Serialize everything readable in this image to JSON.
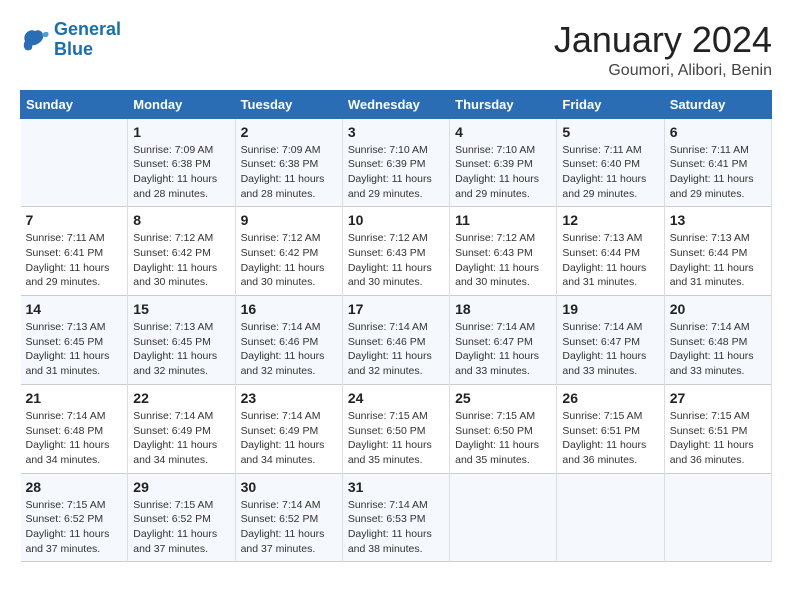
{
  "logo": {
    "line1": "General",
    "line2": "Blue"
  },
  "title": "January 2024",
  "location": "Goumori, Alibori, Benin",
  "headers": [
    "Sunday",
    "Monday",
    "Tuesday",
    "Wednesday",
    "Thursday",
    "Friday",
    "Saturday"
  ],
  "weeks": [
    [
      {
        "day": "",
        "info": ""
      },
      {
        "day": "1",
        "info": "Sunrise: 7:09 AM\nSunset: 6:38 PM\nDaylight: 11 hours\nand 28 minutes."
      },
      {
        "day": "2",
        "info": "Sunrise: 7:09 AM\nSunset: 6:38 PM\nDaylight: 11 hours\nand 28 minutes."
      },
      {
        "day": "3",
        "info": "Sunrise: 7:10 AM\nSunset: 6:39 PM\nDaylight: 11 hours\nand 29 minutes."
      },
      {
        "day": "4",
        "info": "Sunrise: 7:10 AM\nSunset: 6:39 PM\nDaylight: 11 hours\nand 29 minutes."
      },
      {
        "day": "5",
        "info": "Sunrise: 7:11 AM\nSunset: 6:40 PM\nDaylight: 11 hours\nand 29 minutes."
      },
      {
        "day": "6",
        "info": "Sunrise: 7:11 AM\nSunset: 6:41 PM\nDaylight: 11 hours\nand 29 minutes."
      }
    ],
    [
      {
        "day": "7",
        "info": "Sunrise: 7:11 AM\nSunset: 6:41 PM\nDaylight: 11 hours\nand 29 minutes."
      },
      {
        "day": "8",
        "info": "Sunrise: 7:12 AM\nSunset: 6:42 PM\nDaylight: 11 hours\nand 30 minutes."
      },
      {
        "day": "9",
        "info": "Sunrise: 7:12 AM\nSunset: 6:42 PM\nDaylight: 11 hours\nand 30 minutes."
      },
      {
        "day": "10",
        "info": "Sunrise: 7:12 AM\nSunset: 6:43 PM\nDaylight: 11 hours\nand 30 minutes."
      },
      {
        "day": "11",
        "info": "Sunrise: 7:12 AM\nSunset: 6:43 PM\nDaylight: 11 hours\nand 30 minutes."
      },
      {
        "day": "12",
        "info": "Sunrise: 7:13 AM\nSunset: 6:44 PM\nDaylight: 11 hours\nand 31 minutes."
      },
      {
        "day": "13",
        "info": "Sunrise: 7:13 AM\nSunset: 6:44 PM\nDaylight: 11 hours\nand 31 minutes."
      }
    ],
    [
      {
        "day": "14",
        "info": "Sunrise: 7:13 AM\nSunset: 6:45 PM\nDaylight: 11 hours\nand 31 minutes."
      },
      {
        "day": "15",
        "info": "Sunrise: 7:13 AM\nSunset: 6:45 PM\nDaylight: 11 hours\nand 32 minutes."
      },
      {
        "day": "16",
        "info": "Sunrise: 7:14 AM\nSunset: 6:46 PM\nDaylight: 11 hours\nand 32 minutes."
      },
      {
        "day": "17",
        "info": "Sunrise: 7:14 AM\nSunset: 6:46 PM\nDaylight: 11 hours\nand 32 minutes."
      },
      {
        "day": "18",
        "info": "Sunrise: 7:14 AM\nSunset: 6:47 PM\nDaylight: 11 hours\nand 33 minutes."
      },
      {
        "day": "19",
        "info": "Sunrise: 7:14 AM\nSunset: 6:47 PM\nDaylight: 11 hours\nand 33 minutes."
      },
      {
        "day": "20",
        "info": "Sunrise: 7:14 AM\nSunset: 6:48 PM\nDaylight: 11 hours\nand 33 minutes."
      }
    ],
    [
      {
        "day": "21",
        "info": "Sunrise: 7:14 AM\nSunset: 6:48 PM\nDaylight: 11 hours\nand 34 minutes."
      },
      {
        "day": "22",
        "info": "Sunrise: 7:14 AM\nSunset: 6:49 PM\nDaylight: 11 hours\nand 34 minutes."
      },
      {
        "day": "23",
        "info": "Sunrise: 7:14 AM\nSunset: 6:49 PM\nDaylight: 11 hours\nand 34 minutes."
      },
      {
        "day": "24",
        "info": "Sunrise: 7:15 AM\nSunset: 6:50 PM\nDaylight: 11 hours\nand 35 minutes."
      },
      {
        "day": "25",
        "info": "Sunrise: 7:15 AM\nSunset: 6:50 PM\nDaylight: 11 hours\nand 35 minutes."
      },
      {
        "day": "26",
        "info": "Sunrise: 7:15 AM\nSunset: 6:51 PM\nDaylight: 11 hours\nand 36 minutes."
      },
      {
        "day": "27",
        "info": "Sunrise: 7:15 AM\nSunset: 6:51 PM\nDaylight: 11 hours\nand 36 minutes."
      }
    ],
    [
      {
        "day": "28",
        "info": "Sunrise: 7:15 AM\nSunset: 6:52 PM\nDaylight: 11 hours\nand 37 minutes."
      },
      {
        "day": "29",
        "info": "Sunrise: 7:15 AM\nSunset: 6:52 PM\nDaylight: 11 hours\nand 37 minutes."
      },
      {
        "day": "30",
        "info": "Sunrise: 7:14 AM\nSunset: 6:52 PM\nDaylight: 11 hours\nand 37 minutes."
      },
      {
        "day": "31",
        "info": "Sunrise: 7:14 AM\nSunset: 6:53 PM\nDaylight: 11 hours\nand 38 minutes."
      },
      {
        "day": "",
        "info": ""
      },
      {
        "day": "",
        "info": ""
      },
      {
        "day": "",
        "info": ""
      }
    ]
  ]
}
